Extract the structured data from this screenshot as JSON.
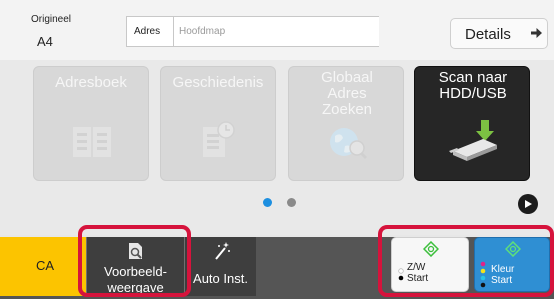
{
  "header": {
    "original_label": "Origineel",
    "original_value": "A4",
    "address_label": "Adres",
    "address_placeholder": "Hoofdmap",
    "details_label": "Details"
  },
  "tiles": [
    {
      "label": "Adresboek",
      "enabled": false,
      "icon": "address-book-icon"
    },
    {
      "label": "Geschiedenis",
      "enabled": false,
      "icon": "history-icon"
    },
    {
      "label": "Globaal Adres Zoeken",
      "enabled": false,
      "icon": "global-search-icon"
    },
    {
      "label": "Scan naar HDD/USB",
      "enabled": true,
      "icon": "usb-drive-icon"
    }
  ],
  "pager": {
    "pages": 2,
    "current": 1
  },
  "bottom": {
    "ca_label": "CA",
    "preview_label": "Voorbeeld-weergave",
    "auto_label": "Auto Inst.",
    "start_bw_mode": "Z/W",
    "start_bw_label": "Start",
    "start_color_mode": "Kleur",
    "start_color_label": "Start"
  },
  "colors": {
    "ca": "#fcc400",
    "highlight": "#d6133c",
    "start_color": "#2f8fd3",
    "accent": "#1d8fe0",
    "start_icon": "#3cbf3c"
  }
}
